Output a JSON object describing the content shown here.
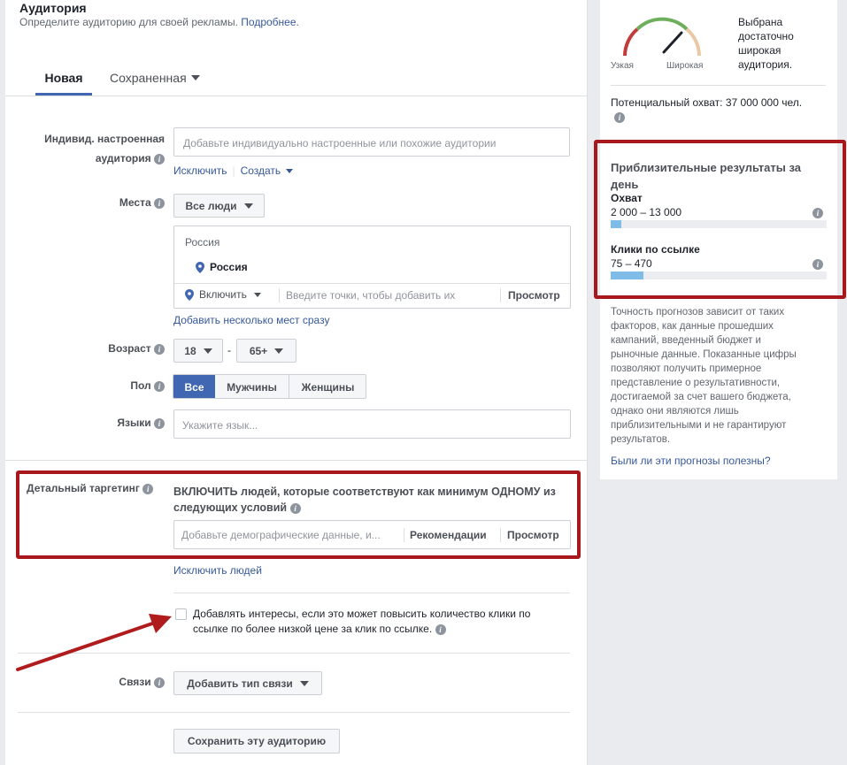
{
  "header": {
    "title": "Аудитория",
    "subtitle": "Определите аудиторию для своей рекламы.",
    "more_link": "Подробнее."
  },
  "tabs": [
    {
      "label": "Новая",
      "active": true
    },
    {
      "label": "Сохраненная",
      "active": false
    }
  ],
  "custom_audience": {
    "label_line1": "Индивид. настроенная",
    "label_line2": "аудитория",
    "placeholder": "Добавьте индивидуально настроенные или похожие аудитории",
    "exclude_link": "Исключить",
    "separator": "|",
    "create_link": "Создать"
  },
  "locations": {
    "label": "Места",
    "dropdown": "Все люди",
    "country_header": "Россия",
    "selected_location": "Россия",
    "include_dropdown": "Включить",
    "input_placeholder": "Введите точки, чтобы добавить их",
    "browse_button": "Просмотр",
    "bulk_link": "Добавить несколько мест сразу"
  },
  "age": {
    "label": "Возраст",
    "min": "18",
    "dash": "-",
    "max": "65+"
  },
  "gender": {
    "label": "Пол",
    "options": [
      "Все",
      "Мужчины",
      "Женщины"
    ],
    "selected": "Все"
  },
  "languages": {
    "label": "Языки",
    "placeholder": "Укажите язык..."
  },
  "detailed_targeting": {
    "label": "Детальный таргетинг",
    "description_line1": "ВКЛЮЧИТЬ людей, которые соответствуют как минимум ОДНОМУ из",
    "description_line2": "следующих условий",
    "input_placeholder": "Добавьте демографические данные, и...",
    "suggestions_button": "Рекомендации",
    "browse_button": "Просмотр",
    "exclude_link": "Исключить людей"
  },
  "expansion": {
    "checked": false,
    "text_line1": "Добавлять интересы, если это может повысить количество клики по",
    "text_line2": "ссылке по более низкой цене за клик по ссылке."
  },
  "connections": {
    "label": "Связи",
    "dropdown": "Добавить тип связи"
  },
  "save_button": "Сохранить эту аудиторию",
  "audience_size": {
    "narrow_label": "Узкая",
    "broad_label": "Широкая",
    "status_line1": "Выбрана",
    "status_line2": "достаточно",
    "status_line3": "широкая",
    "status_line4": "аудитория.",
    "potential_reach": "Потенциальный охват: 37 000 000 чел.",
    "gauge_level": 0.78
  },
  "estimated_results": {
    "title_line1": "Приблизительные результаты за",
    "title_line2": "день",
    "reach_label": "Охват",
    "reach_value": "2 000 – 13 000",
    "reach_fill": 0.05,
    "clicks_label": "Клики по ссылке",
    "clicks_value": "75 – 470",
    "clicks_fill": 0.15
  },
  "disclaimer": {
    "lines": [
      "Точность прогнозов зависит от таких",
      "факторов, как данные прошедших",
      "кампаний, введенный бюджет и",
      "рыночные данные. Показанные цифры",
      "позволяют получить примерное",
      "представление о результативности,",
      "достигаемой за счет вашего бюджета,",
      "однако они являются лишь",
      "приблизительными и не гарантируют",
      "результатов."
    ],
    "feedback_link": "Были ли эти прогнозы полезны?"
  },
  "colors": {
    "accent": "#4267b2",
    "link": "#365899",
    "highlight_border": "#a8171c",
    "arrow": "#b01c1e",
    "bar_fill": "#7fbde8"
  }
}
